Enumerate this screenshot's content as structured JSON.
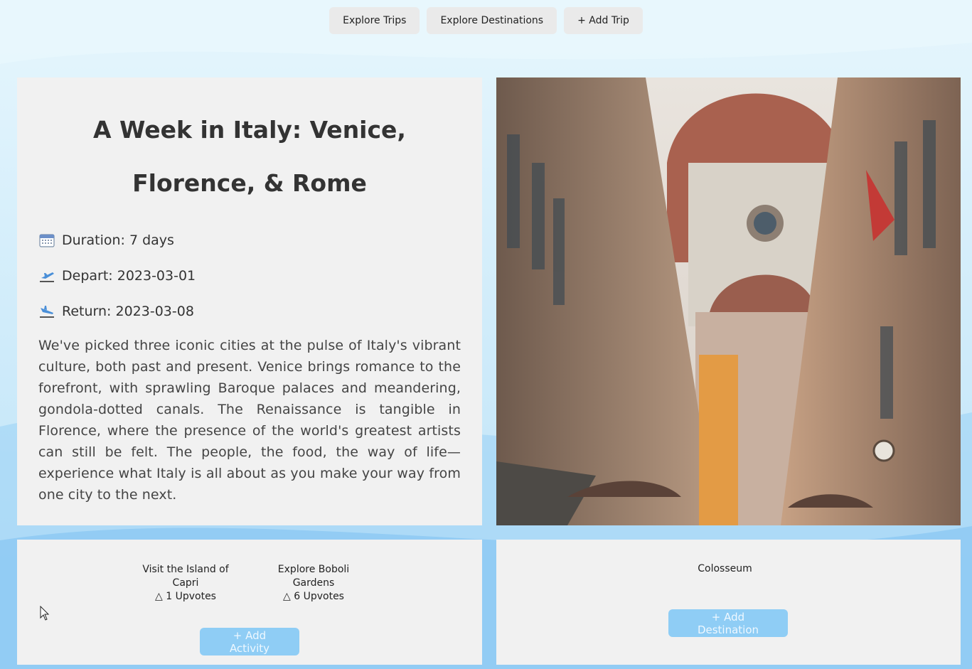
{
  "nav": {
    "items": [
      {
        "label": "Explore Trips"
      },
      {
        "label": "Explore Destinations"
      },
      {
        "label": "+ Add Trip"
      }
    ]
  },
  "trip": {
    "title": "A Week in Italy: Venice, Florence, & Rome",
    "duration": "Duration: 7 days",
    "depart": "Depart: 2023-03-01",
    "return": "Return: 2023-03-08",
    "description": "We've picked three iconic cities at the pulse of Italy's vibrant culture, both past and present. Venice brings romance to the forefront, with sprawling Baroque palaces and meandering, gondola-dotted canals. The Renaissance is tangible in Florence, where the presence of the world's greatest artists can still be felt. The people, the food, the way of life—experience what Italy is all about as you make your way from one city to the next."
  },
  "activities": {
    "items": [
      {
        "name": "Visit the Island of Capri",
        "upvotes": "△ 1 Upvotes"
      },
      {
        "name": "Explore Boboli Gardens",
        "upvotes": "△ 6 Upvotes"
      }
    ],
    "add_label": "+ Add Activity"
  },
  "destinations": {
    "items": [
      {
        "name": "Colosseum"
      }
    ],
    "add_label": "+ Add Destination"
  },
  "icons": {
    "duration": "calendar-icon",
    "depart": "airplane-departure-icon",
    "return": "airplane-arrival-icon"
  },
  "colors": {
    "accent_button": "#8fcdf5",
    "panel": "#f1f1f1",
    "background": "#d6eefb"
  }
}
